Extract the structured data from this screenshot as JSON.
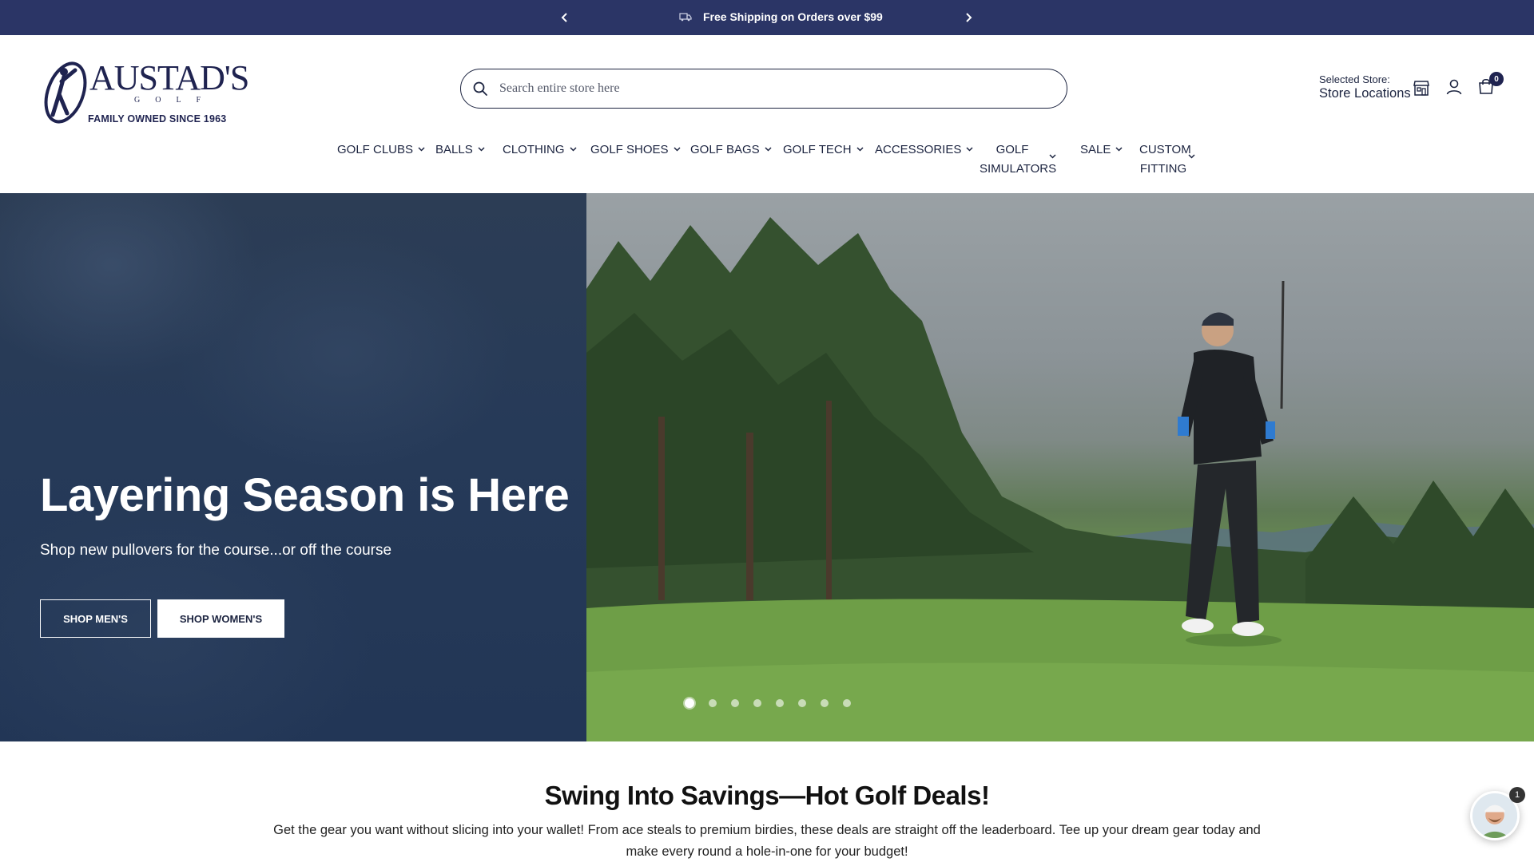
{
  "announcement": {
    "message": "Free Shipping on Orders over $99",
    "icon": "truck-icon"
  },
  "logo": {
    "brand": "AUSTAD'S",
    "sub": "GOLF",
    "tagline": "FAMILY OWNED SINCE 1963"
  },
  "search": {
    "placeholder": "Search entire store here"
  },
  "store": {
    "label": "Selected Store:",
    "value": "Store Locations"
  },
  "cart": {
    "count": "0"
  },
  "nav": {
    "items": [
      {
        "label": "GOLF CLUBS"
      },
      {
        "label": "BALLS"
      },
      {
        "label": "CLOTHING"
      },
      {
        "label": "GOLF SHOES"
      },
      {
        "label": "GOLF BAGS"
      },
      {
        "label": "GOLF TECH"
      },
      {
        "label": "ACCESSORIES"
      },
      {
        "line1": "GOLF",
        "line2": "SIMULATORS"
      },
      {
        "label": "SALE"
      },
      {
        "line1": "CUSTOM",
        "line2": "FITTING"
      }
    ]
  },
  "hero": {
    "title": "Layering Season is Here",
    "subtitle": "Shop new pullovers for the course...or off the course",
    "button_men": "SHOP MEN'S",
    "button_women": "SHOP WOMEN'S",
    "slide_count": 8,
    "active_slide": 1
  },
  "deals": {
    "title": "Swing Into Savings—Hot Golf Deals!",
    "text": "Get the gear you want without slicing into your wallet! From ace steals to premium birdies, these deals are straight off the leaderboard. Tee up your dream gear today and make every round a hole-in-one for your budget!"
  },
  "chat": {
    "badge": "1"
  },
  "colors": {
    "announcement_bg": "#2b3566",
    "brand_navy": "#1f2350",
    "text": "#1c2440"
  }
}
